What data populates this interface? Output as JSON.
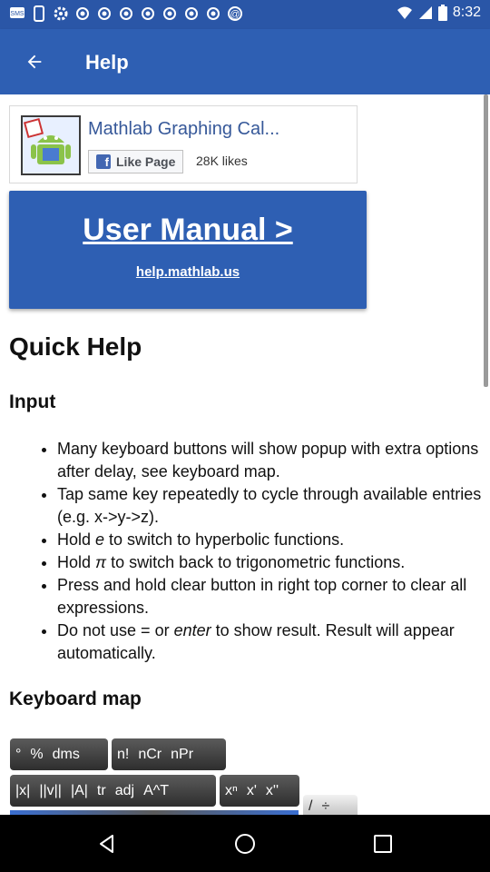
{
  "status_bar": {
    "time": "8:32",
    "notification_icons": [
      "sms-icon",
      "phone-icon",
      "gear-icon",
      "o-icon",
      "o-icon",
      "o-icon",
      "o-icon",
      "o-icon",
      "o-icon",
      "o-icon",
      "o-icon",
      "at-icon"
    ],
    "icons": [
      "wifi-icon",
      "signal-icon",
      "battery-icon"
    ]
  },
  "app_bar": {
    "title": "Help",
    "back_icon": "arrow-back-icon",
    "color": "#2e5fb3"
  },
  "fb_ad": {
    "title": "Mathlab Graphing Cal...",
    "like_label": "Like Page",
    "likes": "28K likes"
  },
  "manual": {
    "title": "User Manual >",
    "url": "help.mathlab.us"
  },
  "quick_help": {
    "title": "Quick Help",
    "input_heading": "Input",
    "tips": [
      "Many keyboard buttons will show popup with extra options after delay, see keyboard map.",
      "Tap same key repeatedly to cycle through available entries (e.g. x->y->z).",
      "Hold e to switch to hyperbolic functions.",
      "Hold π to switch back to trigonometric functions.",
      "Press and hold clear button in right top corner to clear all expressions.",
      "Do not use = or enter to show result. Result will appear automatically."
    ],
    "keyboard_heading": "Keyboard map"
  },
  "keyboard_map": {
    "group1": [
      "°",
      "%",
      "dms"
    ],
    "group2": [
      "n!",
      "nCr",
      "nPr"
    ],
    "group3": [
      "|x|",
      "||v||",
      "|A|",
      "tr",
      "adj",
      "A^T"
    ],
    "group4": [
      "xⁿ",
      "x'",
      "x''"
    ],
    "group5": [
      "/",
      "÷"
    ]
  },
  "nav_bar": {
    "icons": [
      "back-triangle-icon",
      "home-circle-icon",
      "recents-square-icon"
    ]
  }
}
